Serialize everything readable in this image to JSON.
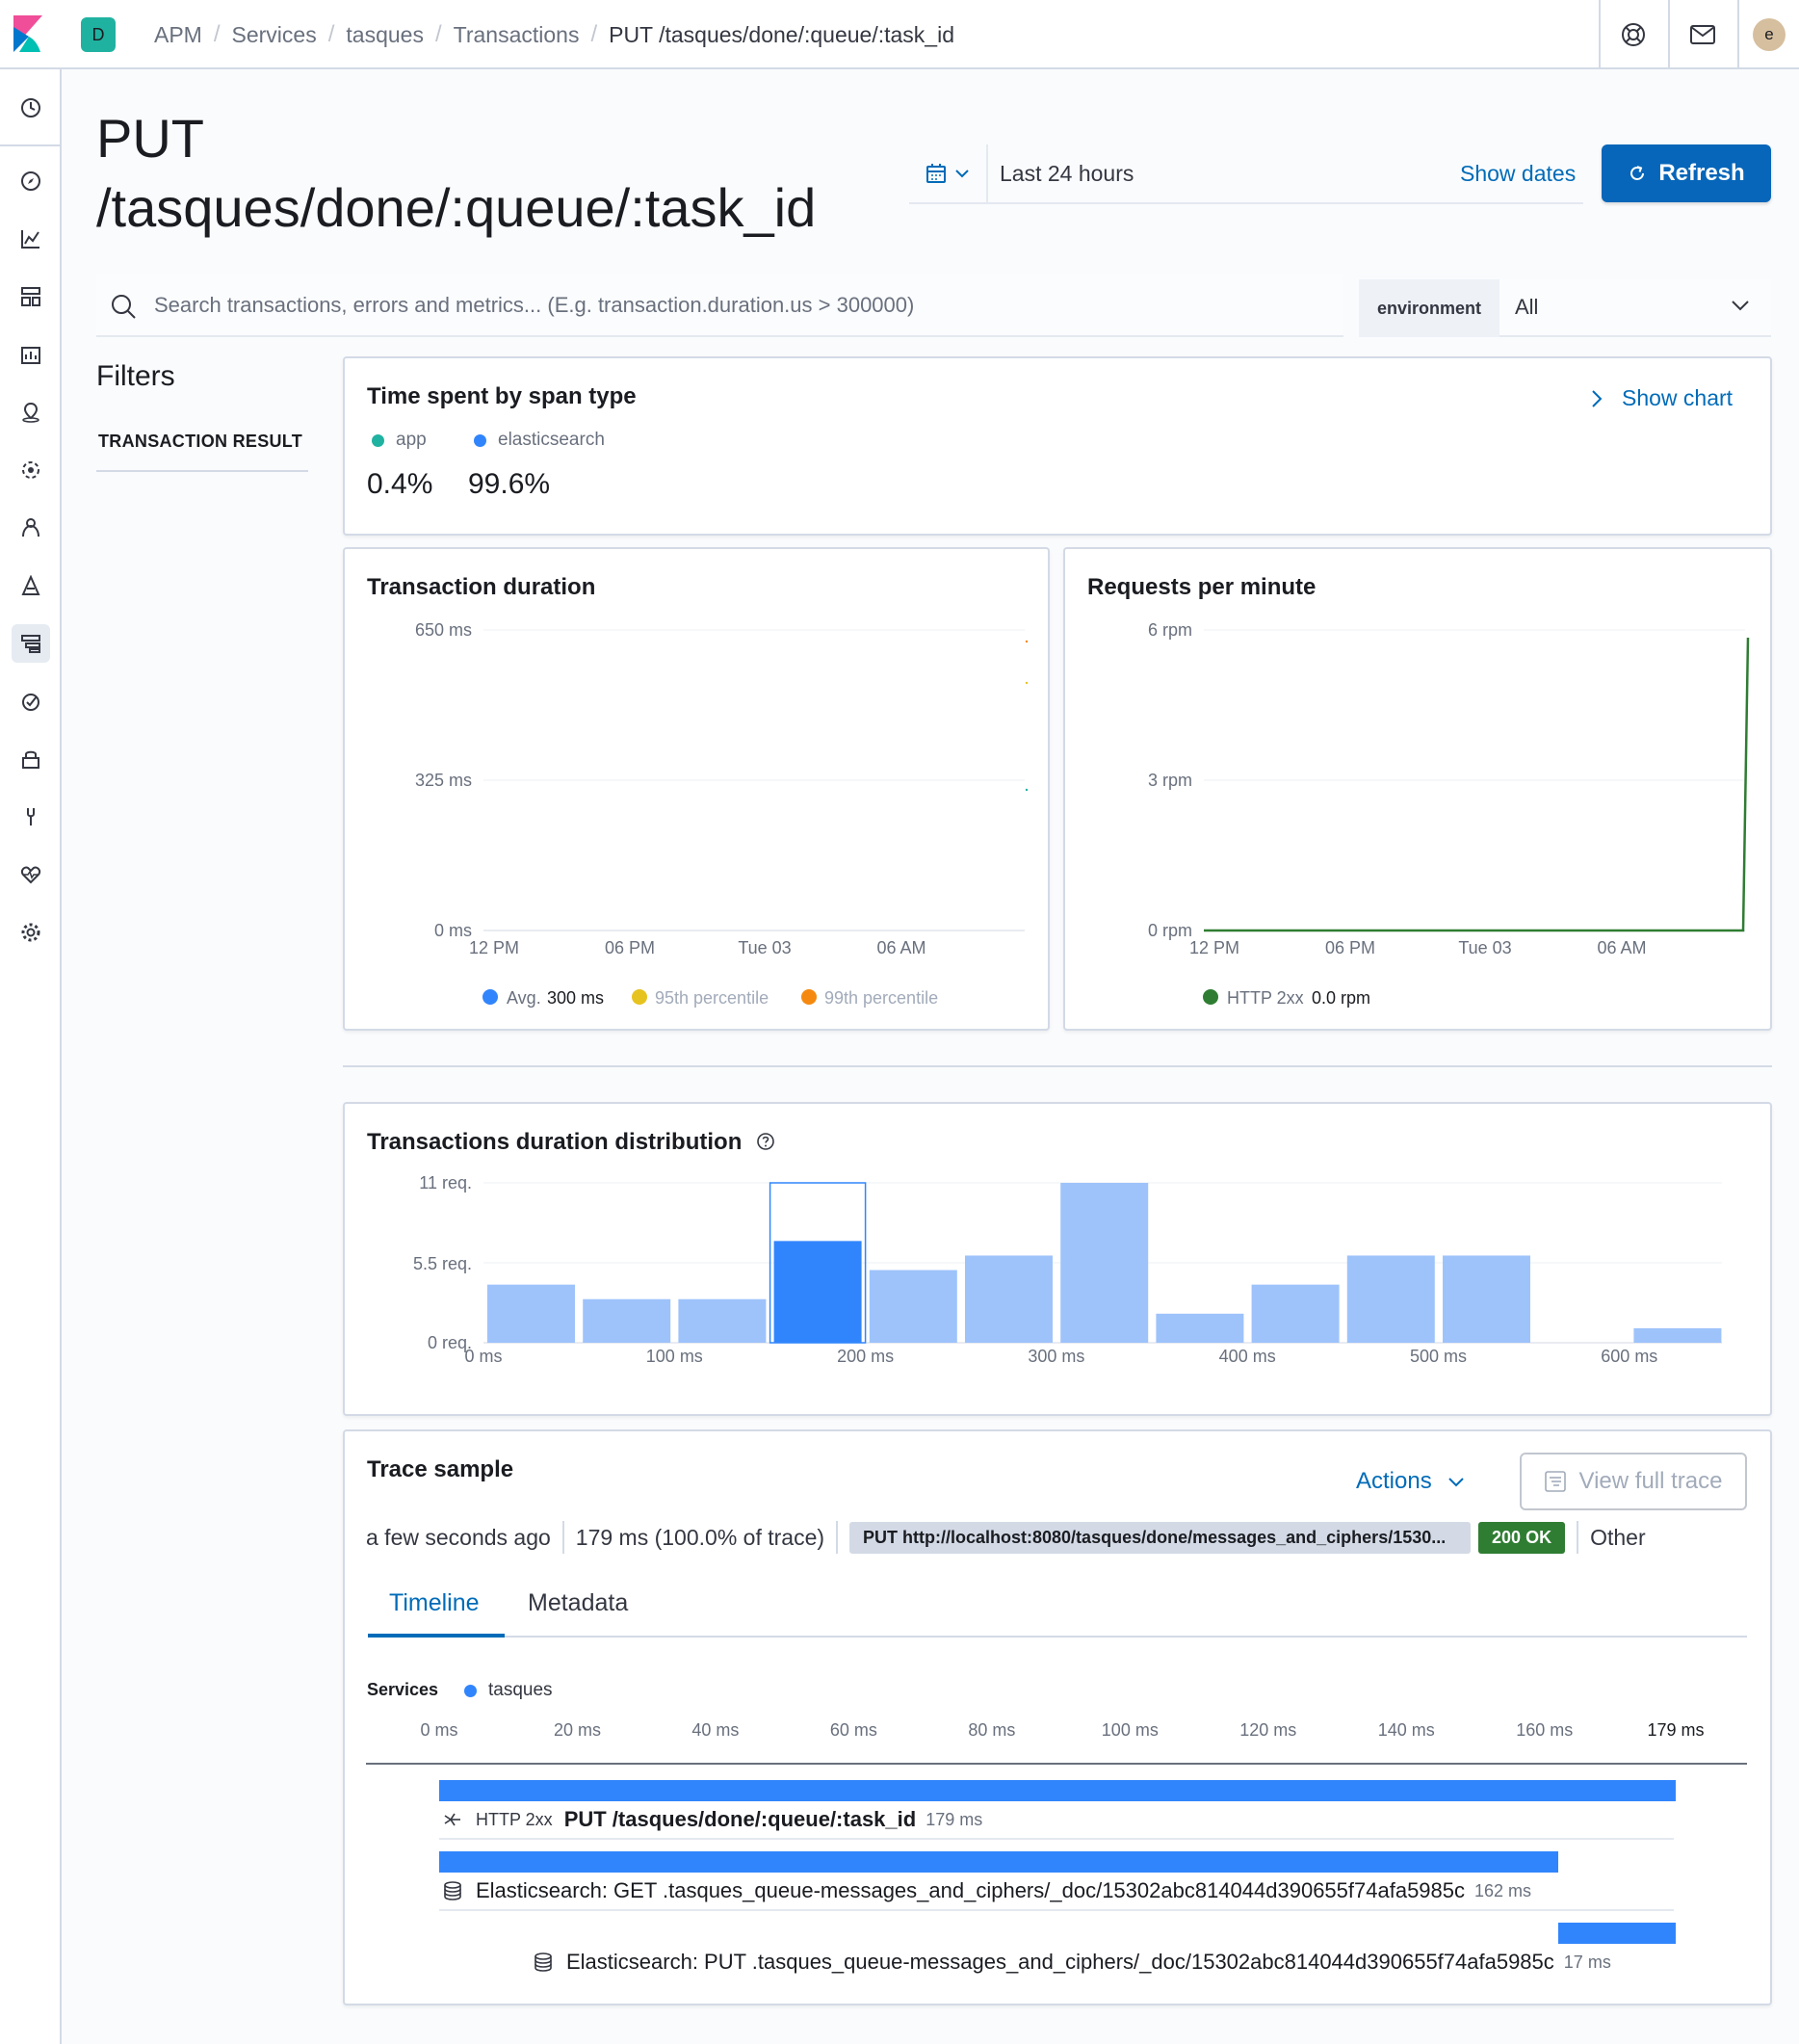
{
  "breadcrumbs": [
    "APM",
    "Services",
    "tasques",
    "Transactions",
    "PUT /tasques/done/:queue/:task_id"
  ],
  "space_initial": "D",
  "user_initial": "e",
  "page": {
    "title_line1": "PUT",
    "title_line2": "/tasques/done/:queue/:task_id"
  },
  "datepicker": {
    "range": "Last 24 hours",
    "show_dates": "Show dates",
    "refresh": "Refresh"
  },
  "search": {
    "placeholder": "Search transactions, errors and metrics... (E.g. transaction.duration.us > 300000)"
  },
  "environment": {
    "label": "environment",
    "value": "All"
  },
  "filters": {
    "title": "Filters",
    "items": [
      "TRANSACTION RESULT"
    ]
  },
  "span_type": {
    "title": "Time spent by span type",
    "show_chart": "Show chart",
    "items": [
      {
        "name": "app",
        "pct": "0.4%",
        "color": "#20b2a1"
      },
      {
        "name": "elasticsearch",
        "pct": "99.6%",
        "color": "#3185fc"
      }
    ]
  },
  "colors": {
    "accent": "#006bb8",
    "refresh_bg": "#0766b9",
    "bar_light": "#9ec3fb",
    "bar_selected": "#3185fc",
    "http2xx": "#2f7d32"
  },
  "chart_data": [
    {
      "type": "line",
      "title": "Transaction duration",
      "x_ticks": [
        "12 PM",
        "06 PM",
        "Tue 03",
        "06 AM"
      ],
      "y_ticks": [
        "650 ms",
        "325 ms",
        "0 ms"
      ],
      "ylim": [
        0,
        650
      ],
      "series": [
        {
          "name": "Avg.",
          "value_label": "300 ms",
          "color": "#3185fc"
        },
        {
          "name": "95th percentile",
          "color": "#e7c320"
        },
        {
          "name": "99th percentile",
          "color": "#f5890f"
        }
      ]
    },
    {
      "type": "line",
      "title": "Requests per minute",
      "x_ticks": [
        "12 PM",
        "06 PM",
        "Tue 03",
        "06 AM"
      ],
      "y_ticks": [
        "6 rpm",
        "3 rpm",
        "0 rpm"
      ],
      "ylim": [
        0,
        6
      ],
      "series": [
        {
          "name": "HTTP 2xx",
          "value_label": "0.0 rpm",
          "color": "#2f7d32"
        }
      ]
    },
    {
      "type": "bar",
      "title": "Transactions duration distribution",
      "x_ticks": [
        "0 ms",
        "100 ms",
        "200 ms",
        "300 ms",
        "400 ms",
        "500 ms",
        "600 ms"
      ],
      "y_ticks": [
        "11 req.",
        "5.5 req.",
        "0 req."
      ],
      "ylim": [
        0,
        11
      ],
      "bucket_starts_ms": [
        0,
        50,
        100,
        150,
        200,
        250,
        300,
        350,
        400,
        450,
        500,
        550,
        600
      ],
      "values": [
        4,
        3,
        3,
        7,
        5,
        6,
        11,
        2,
        4,
        6,
        6,
        0,
        1
      ],
      "selected_bucket_index": 3
    }
  ],
  "trace": {
    "title": "Trace sample",
    "actions": "Actions",
    "view_full_trace": "View full trace",
    "time_ago": "a few seconds ago",
    "duration": "179 ms (100.0% of trace)",
    "url": "PUT http://localhost:8080/tasques/done/messages_and_ciphers/1530...",
    "status": "200 OK",
    "category": "Other",
    "tabs": [
      "Timeline",
      "Metadata"
    ],
    "services_label": "Services",
    "services": [
      {
        "name": "tasques",
        "color": "#3185fc"
      }
    ],
    "timeline_ticks": [
      "0 ms",
      "20 ms",
      "40 ms",
      "60 ms",
      "80 ms",
      "100 ms",
      "120 ms",
      "140 ms",
      "160 ms",
      "179 ms"
    ],
    "total_ms": 179,
    "spans": [
      {
        "tag": "HTTP 2xx",
        "name": "PUT /tasques/done/:queue/:task_id",
        "duration": "179 ms",
        "start_ms": 0,
        "dur_ms": 179
      },
      {
        "name": "Elasticsearch: GET .tasques_queue-messages_and_ciphers/_doc/15302abc814044d390655f74afa5985c",
        "duration": "162 ms",
        "start_ms": 0,
        "dur_ms": 162
      },
      {
        "name": "Elasticsearch: PUT .tasques_queue-messages_and_ciphers/_doc/15302abc814044d390655f74afa5985c",
        "duration": "17 ms",
        "start_ms": 162,
        "dur_ms": 17
      }
    ]
  }
}
